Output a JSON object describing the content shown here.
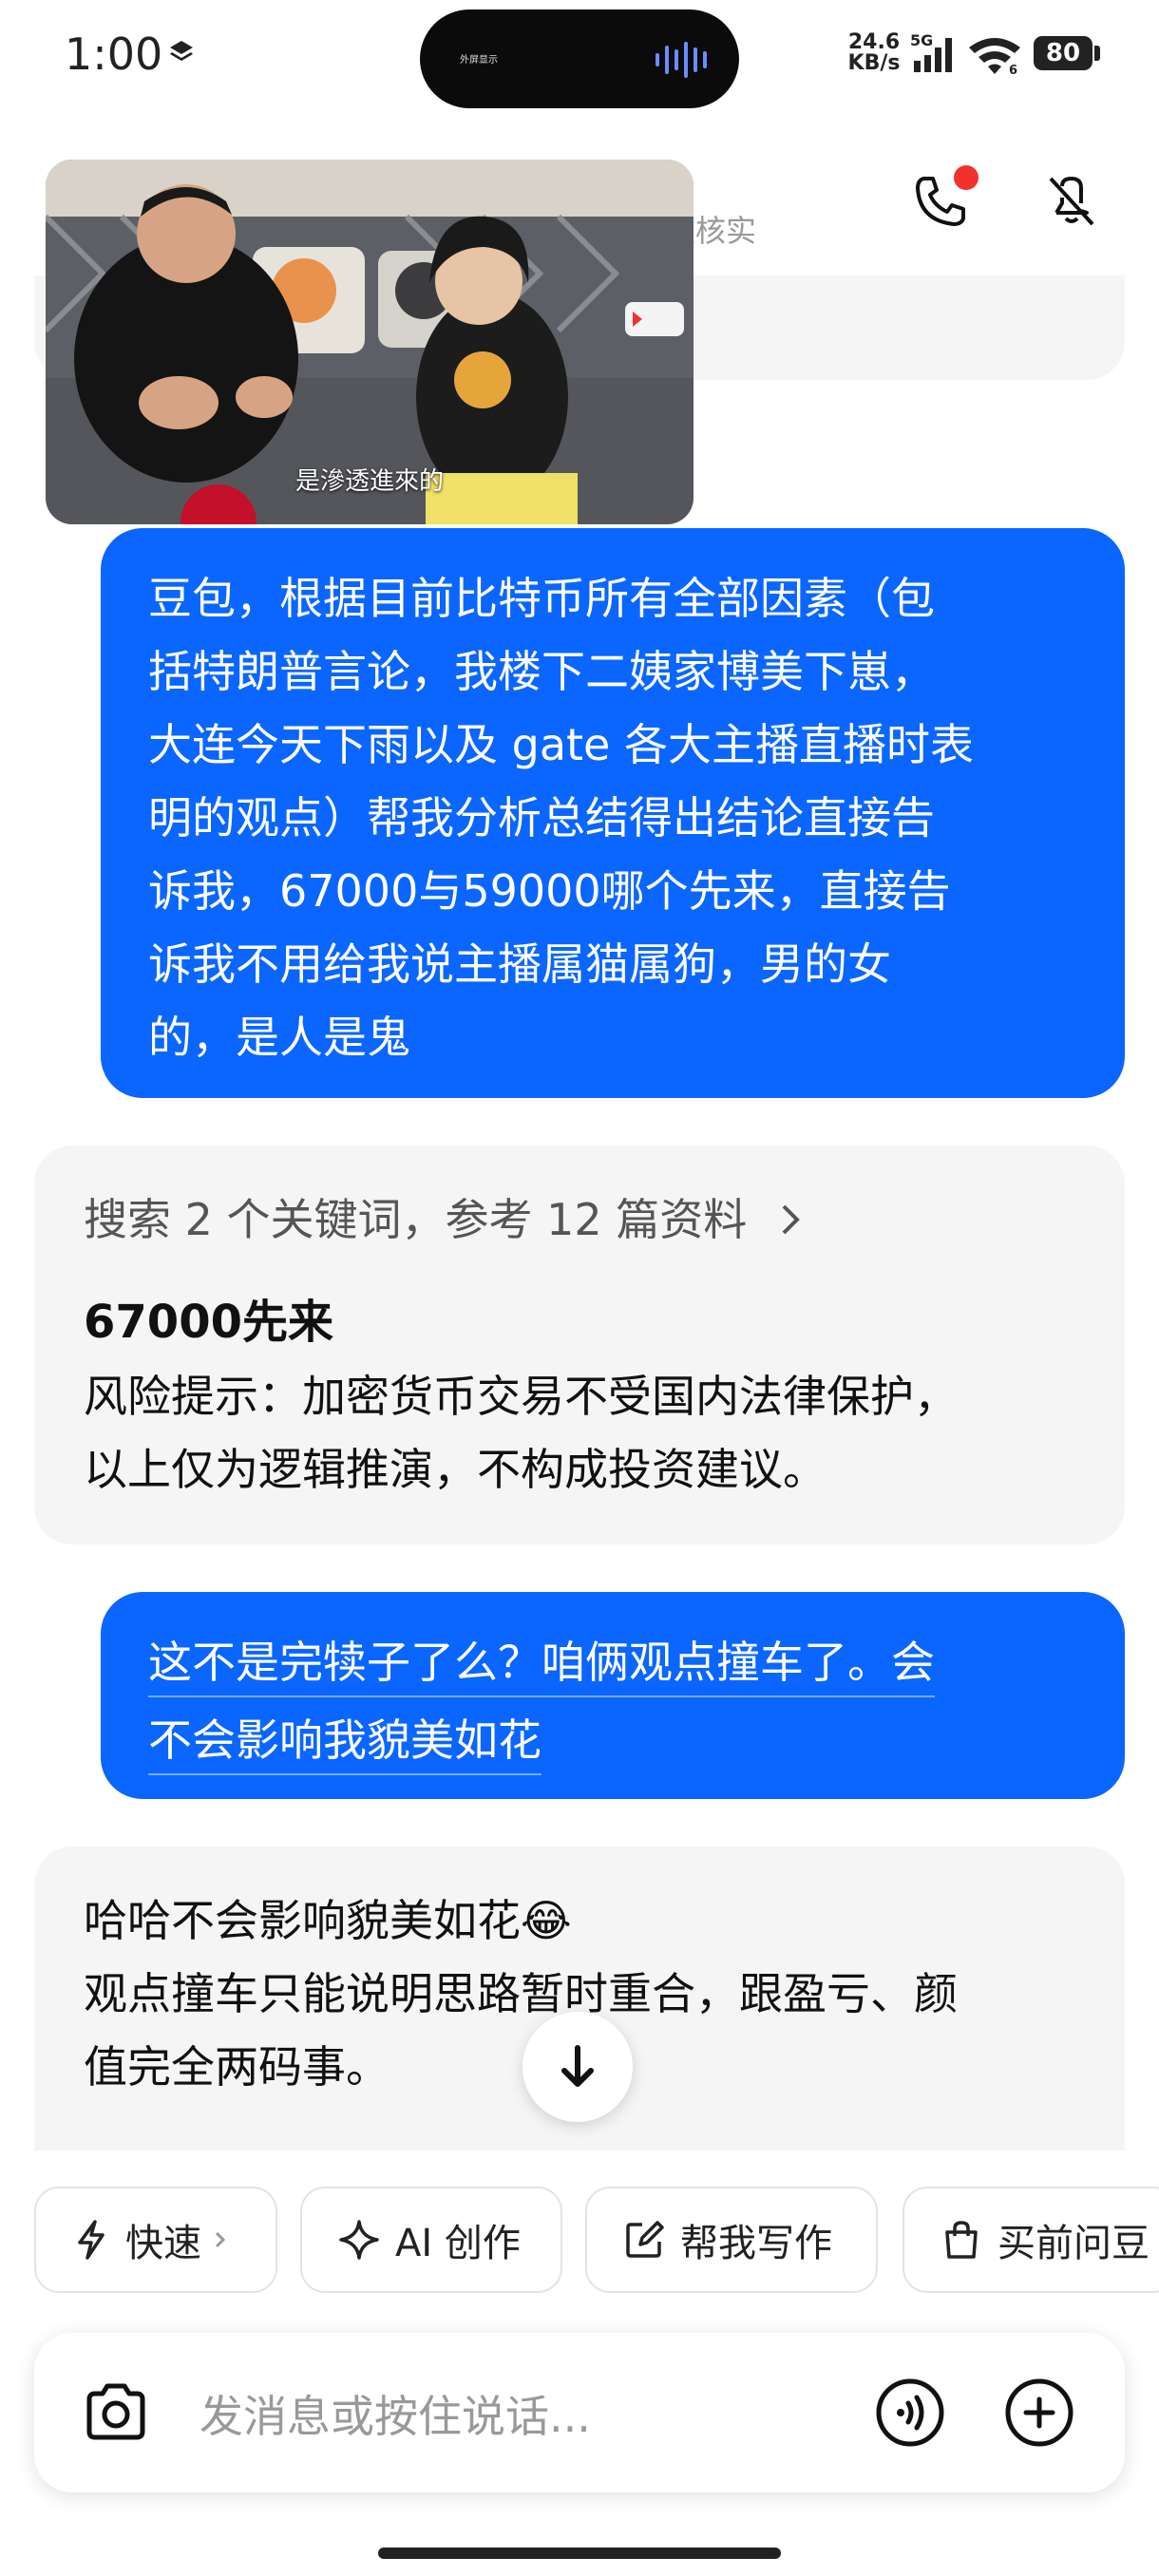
{
  "status_bar": {
    "time": "1:00",
    "island_text": "外屏显示",
    "net_speed_value": "24.6",
    "net_speed_unit": "KB/s",
    "network": "5G",
    "wifi_badge": "6",
    "battery": "80"
  },
  "header": {
    "subtitle_fragment": "认核实"
  },
  "video": {
    "caption": "是滲透進來的"
  },
  "messages": {
    "user1_lines": [
      "豆包，根据目前比特币所有全部因素（包",
      "括特朗普言论，我楼下二姨家博美下崽，",
      "大连今天下雨以及 gate 各大主播直播时表",
      "明的观点）帮我分析总结得出结论直接告",
      "诉我，67000与59000哪个先来，直接告",
      "诉我不用给我说主播属猫属狗，男的女",
      "的，是人是鬼"
    ],
    "bot1": {
      "search_summary": "搜索 2 个关键词，参考 12 篇资料",
      "answer_title": "67000先来",
      "answer_lines": [
        "风险提示：加密货币交易不受国内法律保护，",
        "以上仅为逻辑推演，不构成投资建议。"
      ]
    },
    "user2_lines": [
      "这不是完犊子了么？咱俩观点撞车了。会",
      "不会影响我貌美如花"
    ],
    "bot2_lines": [
      "哈哈不会影响貌美如花😂",
      "观点撞车只能说明思路暂时重合，跟盈亏、颜",
      "值完全两码事。"
    ]
  },
  "chips": {
    "fast": "快速",
    "ai_create": "AI 创作",
    "help_write": "帮我写作",
    "shop_ask": "买前问豆"
  },
  "input": {
    "placeholder": "发消息或按住说话..."
  },
  "colors": {
    "user_bubble": "#0a66ff",
    "bot_bubble": "#f5f5f5",
    "notification_dot": "#f2312c"
  }
}
